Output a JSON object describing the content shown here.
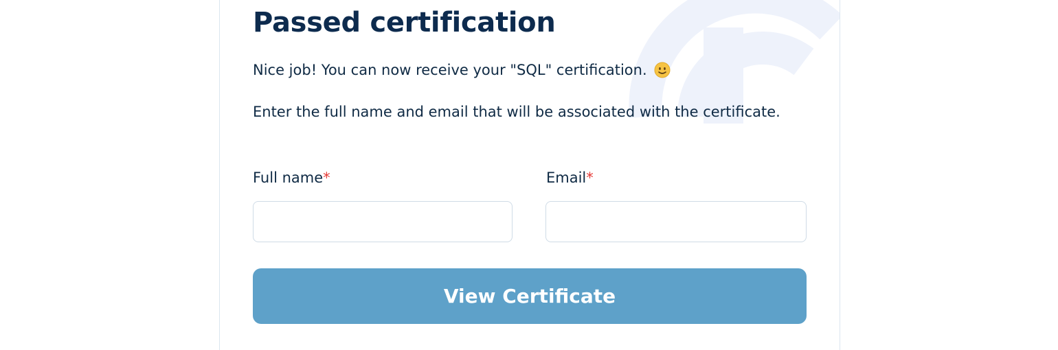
{
  "certification": {
    "title": "Passed certification",
    "intro": "Nice job! You can now receive your \"SQL\" certification.",
    "instructions": "Enter the full name and email that will be associated with the certificate.",
    "fields": {
      "full_name": {
        "label": "Full name",
        "required_mark": "*",
        "value": "",
        "placeholder": ""
      },
      "email": {
        "label": "Email",
        "required_mark": "*",
        "value": "",
        "placeholder": ""
      }
    },
    "submit_label": "View Certificate"
  },
  "icons": {
    "intro_emoji": "slightly-smiling-face-icon",
    "background": "brand-logo-watermark"
  },
  "colors": {
    "title": "#0d2b4e",
    "text": "#0f2a44",
    "required": "#e53935",
    "button_bg": "#5ea1c9",
    "button_text": "#ffffff",
    "watermark": "#eef2fb",
    "input_border": "#cfdbe6"
  }
}
